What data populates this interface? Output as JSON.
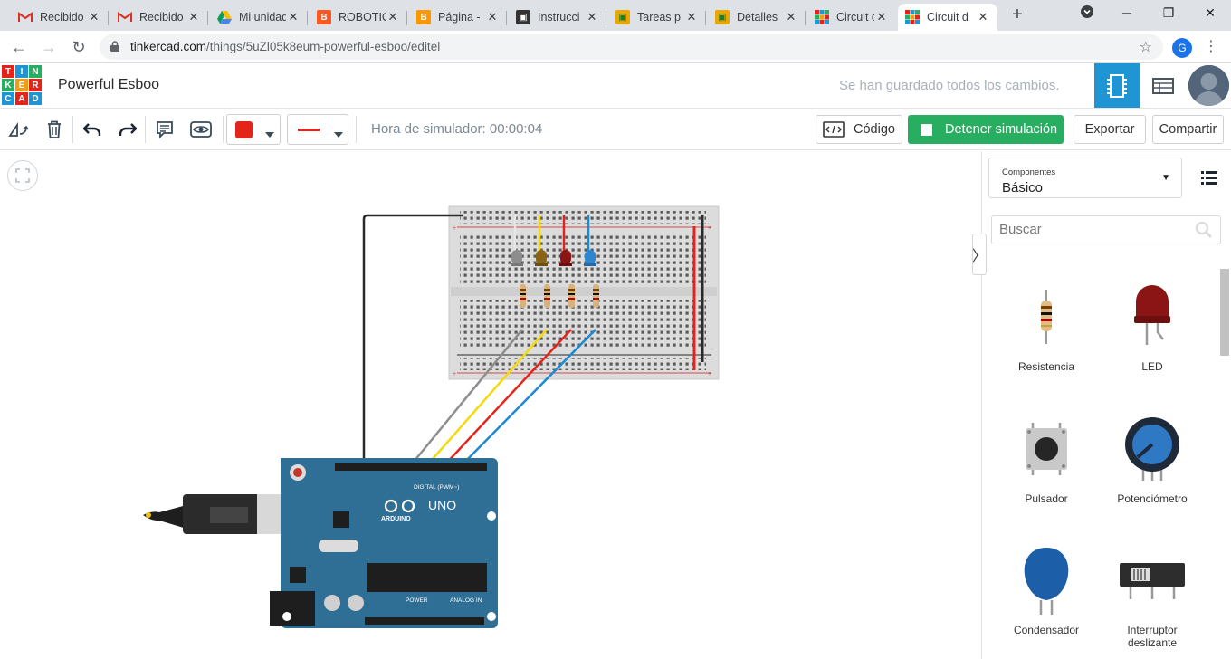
{
  "browser": {
    "tabs": [
      {
        "title": "Recibido",
        "favicon": "gmail-icon"
      },
      {
        "title": "Recibido",
        "favicon": "gmail-icon"
      },
      {
        "title": "Mi unidad",
        "favicon": "drive-icon"
      },
      {
        "title": "ROBOTIC",
        "favicon": "blogger-icon"
      },
      {
        "title": "Página -",
        "favicon": "blogger-icon"
      },
      {
        "title": "Instrucci",
        "favicon": "classroom-icon"
      },
      {
        "title": "Tareas p",
        "favicon": "classroom-icon"
      },
      {
        "title": "Detalles",
        "favicon": "classroom-icon"
      },
      {
        "title": "Circuit d",
        "favicon": "tinkercad-icon"
      },
      {
        "title": "Circuit d",
        "favicon": "tinkercad-icon"
      }
    ],
    "url_host": "tinkercad.com",
    "url_path": "/things/5uZl05k8eum-powerful-esboo/editel",
    "profile_initial": "G"
  },
  "app": {
    "logo_letters": [
      "T",
      "I",
      "N",
      "K",
      "E",
      "R",
      "C",
      "A",
      "D"
    ],
    "project_name": "Powerful Esboo",
    "saved_status": "Se han guardado todos los cambios."
  },
  "toolbar": {
    "sim_time": "Hora de simulador: 00:00:04",
    "code_label": "Código",
    "stop_label": "Detener simulación",
    "export_label": "Exportar",
    "share_label": "Compartir",
    "color_value": "#e3241b"
  },
  "sidebar": {
    "components_label": "Componentes",
    "components_value": "Básico",
    "search_placeholder": "Buscar",
    "items": [
      {
        "label": "Resistencia",
        "icon": "resistor-icon"
      },
      {
        "label": "LED",
        "icon": "led-icon"
      },
      {
        "label": "Pulsador",
        "icon": "pushbutton-icon"
      },
      {
        "label": "Potenciómetro",
        "icon": "potentiometer-icon"
      },
      {
        "label": "Condensador",
        "icon": "capacitor-icon"
      },
      {
        "label": "Interruptor deslizante",
        "icon": "slide-switch-icon"
      }
    ]
  },
  "circuit": {
    "arduino_model": "UNO",
    "arduino_brand": "ARDUINO",
    "digital_label": "DIGITAL (PWM~)",
    "power_label": "POWER",
    "analog_label": "ANALOG IN",
    "led_colors": [
      "#8d8d8d",
      "#8a6414",
      "#8b1414",
      "#2f86d0"
    ],
    "wire_colors": [
      "#8e8e8e",
      "#f5d90a",
      "#e3241b",
      "#1b8ad1"
    ]
  }
}
